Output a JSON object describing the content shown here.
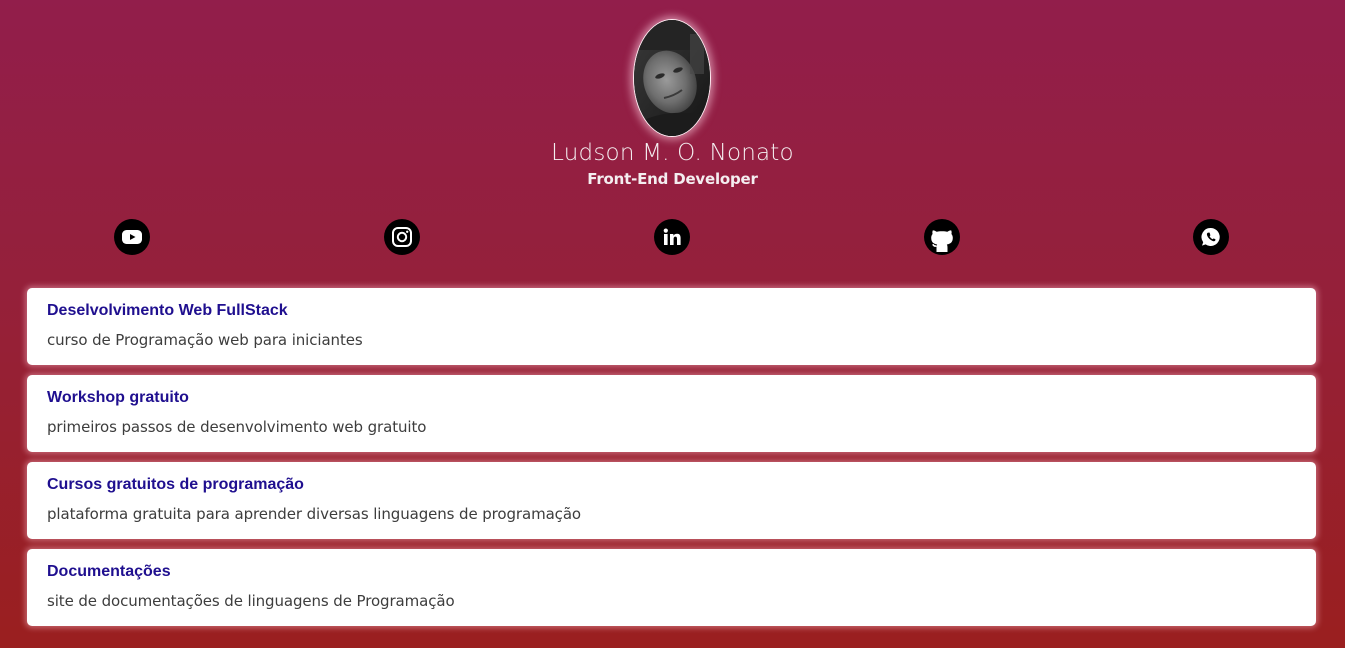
{
  "profile": {
    "name": "Ludson M. O. Nonato",
    "role": "Front-End Developer"
  },
  "social": [
    {
      "icon": "youtube-icon"
    },
    {
      "icon": "instagram-icon"
    },
    {
      "icon": "linkedin-icon"
    },
    {
      "icon": "github-icon"
    },
    {
      "icon": "whatsapp-icon"
    }
  ],
  "links": [
    {
      "title": "Deselvolvimento Web FullStack",
      "description": "curso de Programação web para iniciantes"
    },
    {
      "title": "Workshop gratuito",
      "description": "primeiros passos de desenvolvimento web gratuito"
    },
    {
      "title": "Cursos gratuitos de programação",
      "description": "plataforma gratuita para aprender diversas linguagens de programação"
    },
    {
      "title": "Documentações",
      "description": "site de documentações de linguagens de Programação"
    }
  ],
  "colors": {
    "background_top": "#921e4b",
    "background_bottom": "#9a1f1f",
    "card_title": "#1f0f8f",
    "card_text": "#3d3d3d",
    "icon": "#000000"
  }
}
